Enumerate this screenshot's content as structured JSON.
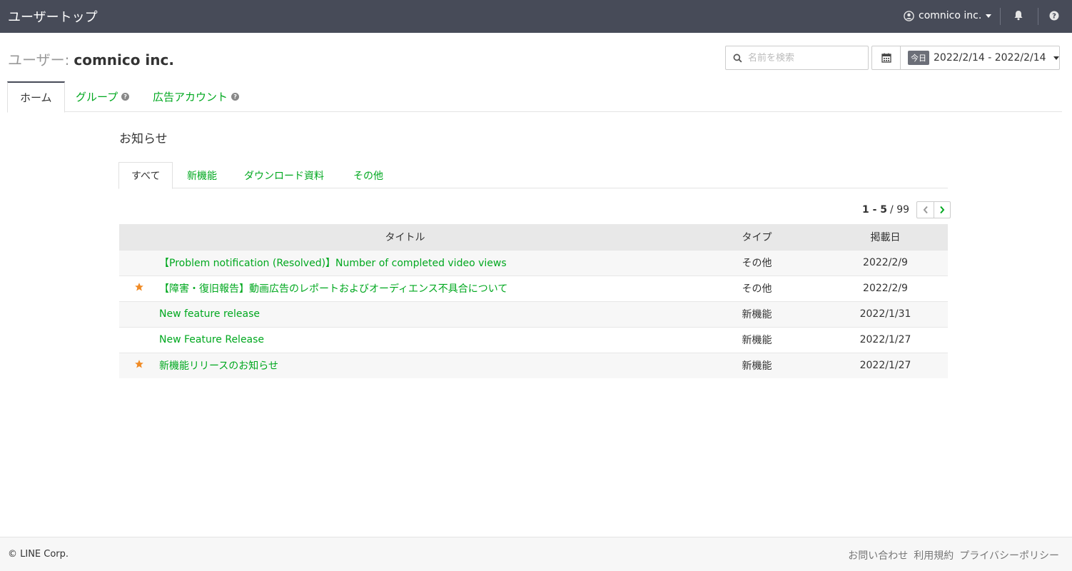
{
  "topbar": {
    "title": "ユーザートップ",
    "user_name": "comnico inc."
  },
  "header": {
    "title_prefix": "ユーザー:",
    "title_name": "comnico inc.",
    "search_placeholder": "名前を検索",
    "date_badge": "今日",
    "date_range": "2022/2/14 - 2022/2/14"
  },
  "main_tabs": [
    {
      "label": "ホーム"
    },
    {
      "label": "グループ"
    },
    {
      "label": "広告アカウント"
    }
  ],
  "news": {
    "title": "お知らせ",
    "tabs": [
      {
        "label": "すべて"
      },
      {
        "label": "新機能"
      },
      {
        "label": "ダウンロード資料"
      },
      {
        "label": "その他"
      }
    ],
    "pager": {
      "range": "1 - 5",
      "total": "/ 99"
    },
    "columns": {
      "title": "タイトル",
      "type": "タイプ",
      "date": "掲載日"
    },
    "rows": [
      {
        "title": "【Problem notification (Resolved)】Number of completed video views",
        "type": "その他",
        "date": "2022/2/9"
      },
      {
        "title": "【障害・復旧報告】動画広告のレポートおよびオーディエンス不具合について",
        "type": "その他",
        "date": "2022/2/9"
      },
      {
        "title": "New feature release",
        "type": "新機能",
        "date": "2022/1/31"
      },
      {
        "title": "New Feature Release",
        "type": "新機能",
        "date": "2022/1/27"
      },
      {
        "title": "新機能リリースのお知らせ",
        "type": "新機能",
        "date": "2022/1/27"
      }
    ]
  },
  "footer": {
    "copyright": "© LINE Corp.",
    "links": [
      "お問い合わせ",
      "利用規約",
      "プライバシーポリシー"
    ]
  },
  "colors": {
    "accent": "#00a81f",
    "topbar": "#474b58",
    "star": "#f08a24"
  }
}
